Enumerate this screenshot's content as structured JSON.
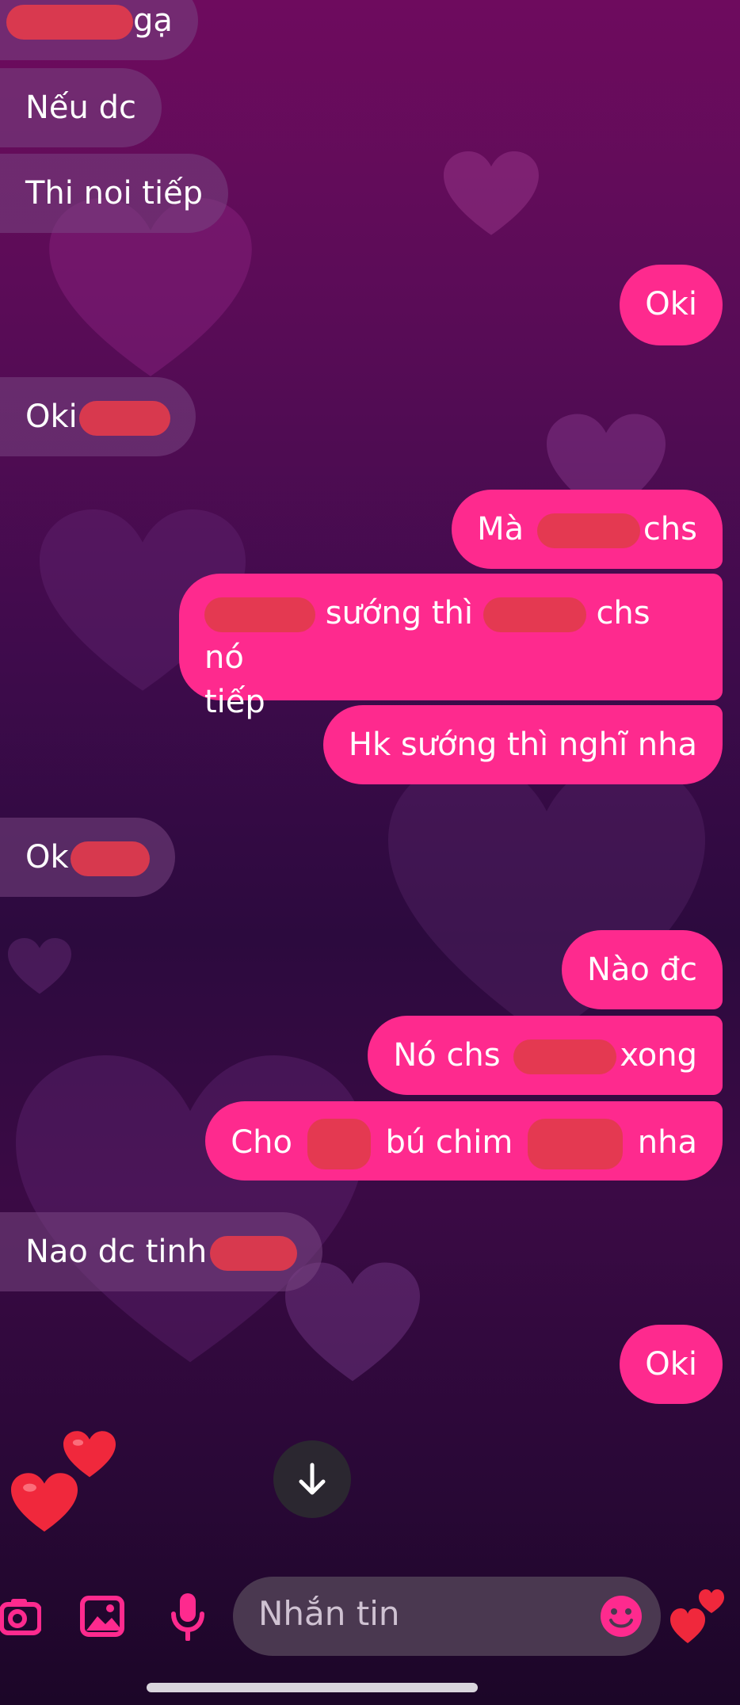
{
  "chat": {
    "messages": [
      {
        "dir": "in",
        "text": "gạ"
      },
      {
        "dir": "in",
        "text": "Nếu dc"
      },
      {
        "dir": "in",
        "text": "Thi noi tiếp"
      },
      {
        "dir": "out",
        "text": "Oki"
      },
      {
        "dir": "in",
        "text": "Oki"
      },
      {
        "dir": "out",
        "text": "Mà",
        "text2": "chs"
      },
      {
        "dir": "out",
        "text": "sướng thì",
        "text2": "chs nó",
        "text3": "tiếp"
      },
      {
        "dir": "out",
        "text": "Hk sướng thì nghĩ nha"
      },
      {
        "dir": "in",
        "text": "Ok"
      },
      {
        "dir": "out",
        "text": "Nào đc"
      },
      {
        "dir": "out",
        "text": "Nó chs",
        "text2": "xong"
      },
      {
        "dir": "out",
        "text": "Cho",
        "text2": "bú chim",
        "text3": "nha"
      },
      {
        "dir": "in",
        "text": "Nao dc tinh"
      },
      {
        "dir": "out",
        "text": "Oki"
      }
    ]
  },
  "composer": {
    "placeholder": "Nhắn tin",
    "icons": [
      "camera-icon",
      "image-icon",
      "microphone-icon",
      "emoji-icon",
      "heart-icon"
    ]
  },
  "colors": {
    "outgoing_bubble": "#fe2a8e",
    "incoming_bubble": "#7a4682",
    "accent_icon": "#fe2a8e",
    "redaction": "#e23b4c"
  }
}
